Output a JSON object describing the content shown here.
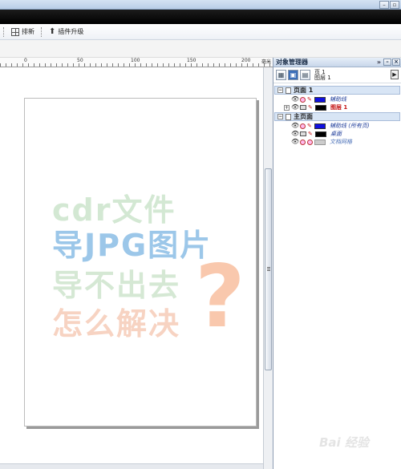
{
  "toolbar": {
    "layout_label": "排新",
    "plugin_label": "插件升级"
  },
  "ruler": {
    "marks": [
      "0",
      "50",
      "100",
      "150",
      "200"
    ],
    "unit": "毫米"
  },
  "canvas": {
    "watermark": [
      "cdr文件",
      "导JPG图片",
      "导不出去",
      "怎么解决"
    ],
    "question_mark": "?"
  },
  "panel": {
    "title": "对象管理器",
    "layer_info_line1": "页 1",
    "layer_info_line2": "图层 1",
    "tree": {
      "page1": {
        "label": "页面 1",
        "layers": [
          {
            "label": "辅助线",
            "color": "#1010e0"
          },
          {
            "label": "图层 1",
            "color": "#000000"
          }
        ]
      },
      "master": {
        "label": "主页面",
        "layers": [
          {
            "label": "辅助线 (所有页)",
            "color": "#1010e0"
          },
          {
            "label": "桌面",
            "color": "#000000"
          },
          {
            "label": "文档网格",
            "color": "#cccccc"
          }
        ]
      }
    }
  },
  "watermark_brand": "Bai 经验"
}
